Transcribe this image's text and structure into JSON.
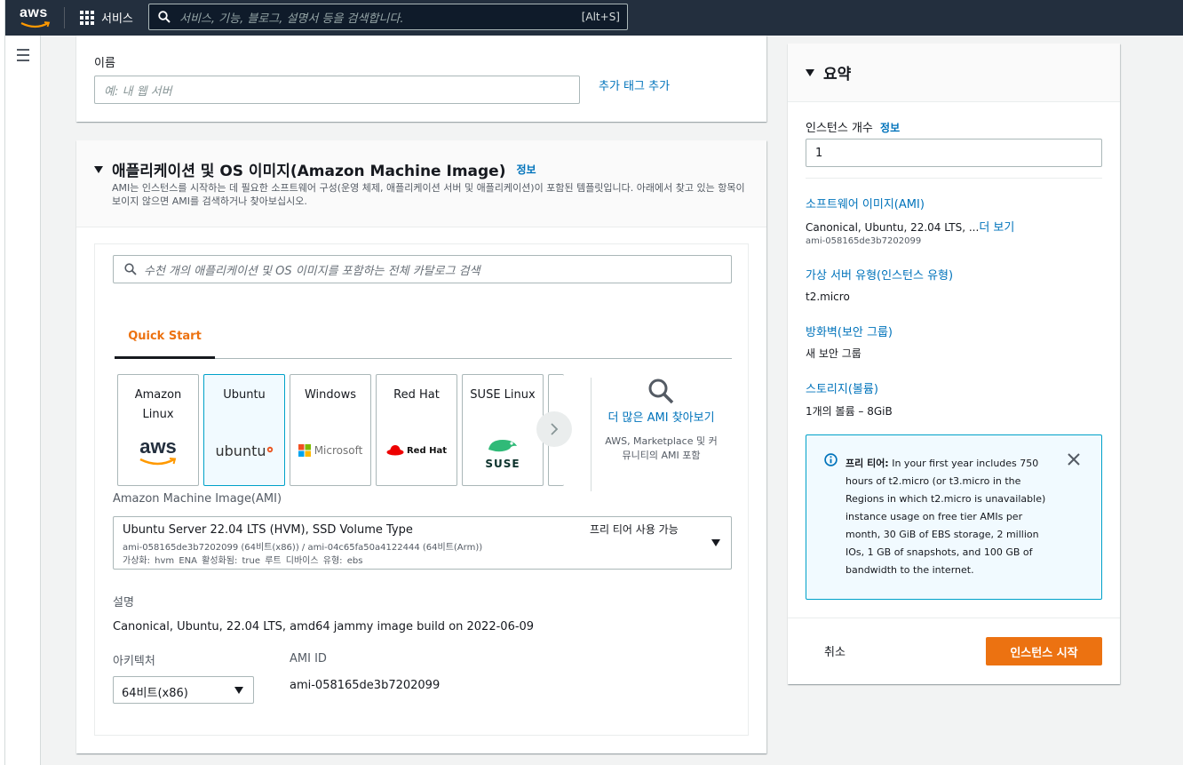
{
  "nav": {
    "logo_text": "aws",
    "services_label": "서비스",
    "search_placeholder": "서비스, 기능, 블로그, 설명서 등을 검색합니다.",
    "search_shortcut": "[Alt+S]"
  },
  "name_section": {
    "label": "이름",
    "placeholder": "예: 내 웹 서버",
    "add_tag_link": "추가 태그 추가"
  },
  "ami_section": {
    "title": "애플리케이션 및 OS 이미지(Amazon Machine Image)",
    "info": "정보",
    "description": "AMI는 인스턴스를 시작하는 데 필요한 소프트웨어 구성(운영 체제, 애플리케이션 서버 및 애플리케이션)이 포함된 템플릿입니다. 아래에서 찾고 있는 항목이 보이지 않으면 AMI를 검색하거나 찾아보십시오.",
    "catalog_search_placeholder": "수천 개의 애플리케이션 및 OS 이미지를 포함하는 전체 카탈로그 검색",
    "tab_quick_start": "Quick Start",
    "os_cards": [
      {
        "name": "Amazon Linux",
        "logo": "aws"
      },
      {
        "name": "Ubuntu",
        "logo": "ubuntu"
      },
      {
        "name": "Windows",
        "logo": "Microsoft"
      },
      {
        "name": "Red Hat",
        "logo": "Red Hat"
      },
      {
        "name": "SUSE Linux",
        "logo": "SUSE"
      }
    ],
    "more_ami_title": "더 많은 AMI 찾아보기",
    "more_ami_sub": "AWS, Marketplace 및 커뮤니티의 AMI 포함",
    "ami_label": "Amazon Machine Image(AMI)",
    "ami_selected": {
      "name": "Ubuntu Server 22.04 LTS (HVM), SSD Volume Type",
      "ids": "ami-058165de3b7202099 (64비트(x86)) / ami-04c65fa50a4122444 (64비트(Arm))",
      "details": "가상화: hvm    ENA 활성화됨: true    루트 디바이스 유형: ebs",
      "free_tier": "프리 티어 사용 가능"
    },
    "desc_label": "설명",
    "desc_value": "Canonical, Ubuntu, 22.04 LTS, amd64 jammy image build on 2022-06-09",
    "arch_label": "아키텍처",
    "arch_value": "64비트(x86)",
    "ami_id_label": "AMI ID",
    "ami_id_value": "ami-058165de3b7202099"
  },
  "summary": {
    "title": "요약",
    "instance_count_label": "인스턴스 개수",
    "info": "정보",
    "instance_count_value": "1",
    "software_image_link": "소프트웨어 이미지(AMI)",
    "software_image_value": "Canonical, Ubuntu, 22.04 LTS, ...",
    "see_more": "더 보기",
    "software_image_id": "ami-058165de3b7202099",
    "server_type_link": "가상 서버 유형(인스턴스 유형)",
    "server_type_value": "t2.micro",
    "firewall_link": "방화벽(보안 그룹)",
    "firewall_value": "새 보안 그룹",
    "storage_link": "스토리지(볼륨)",
    "storage_value": "1개의 볼륨 – 8GiB",
    "free_tier_title": "프리 티어:",
    "free_tier_text": "In your first year includes 750 hours of t2.micro (or t3.micro in the Regions in which t2.micro is unavailable) instance usage on free tier AMIs per month, 30 GiB of EBS storage, 2 million IOs, 1 GB of snapshots, and 100 GB of bandwidth to the internet.",
    "cancel_label": "취소",
    "launch_label": "인스턴스 시작"
  },
  "colors": {
    "nav_bg": "#232f3e",
    "link": "#0073bb",
    "accent": "#ec7211",
    "info_border": "#00a1c9"
  }
}
